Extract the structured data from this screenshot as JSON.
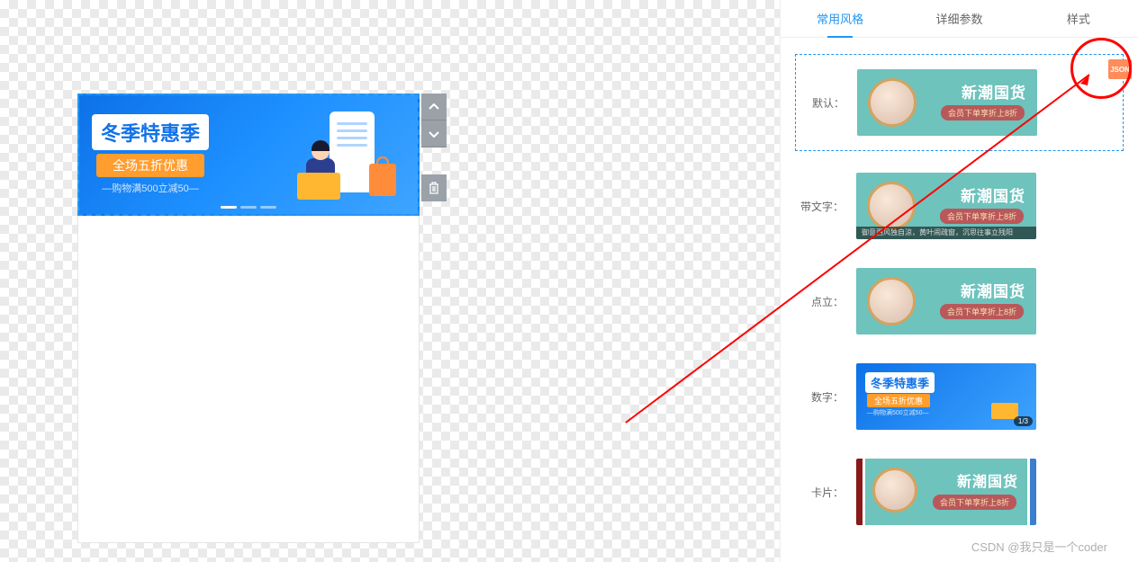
{
  "canvas": {
    "banner": {
      "title": "冬季特惠季",
      "subtitle": "全场五折优惠",
      "line": "—购物满500立减50—"
    }
  },
  "panel": {
    "tabs": [
      "常用风格",
      "详细参数",
      "样式"
    ],
    "active_tab": 0,
    "styles": [
      {
        "label": "默认：",
        "selected": true,
        "variant": "teal",
        "title": "新潮国货",
        "pill": "会员下单享折上8折"
      },
      {
        "label": "带文字：",
        "selected": false,
        "variant": "teal-caption",
        "title": "新潮国货",
        "pill": "会员下单享折上8折",
        "caption": "御意西风独自涼，黄叶闹疏窗，沉思往事立残阳"
      },
      {
        "label": "点立：",
        "selected": false,
        "variant": "teal",
        "title": "新潮国货",
        "pill": "会员下单享折上8折"
      },
      {
        "label": "数字：",
        "selected": false,
        "variant": "blue",
        "title": "冬季特惠季",
        "sub": "全场五折优惠",
        "line": "—购物满500立减50—",
        "num": "1/3"
      },
      {
        "label": "卡片：",
        "selected": false,
        "variant": "card",
        "title": "新潮国货",
        "pill": "会员下单享折上8折"
      }
    ]
  },
  "annotation": {
    "json_badge": "JSON"
  },
  "watermark": "CSDN @我只是一个coder"
}
